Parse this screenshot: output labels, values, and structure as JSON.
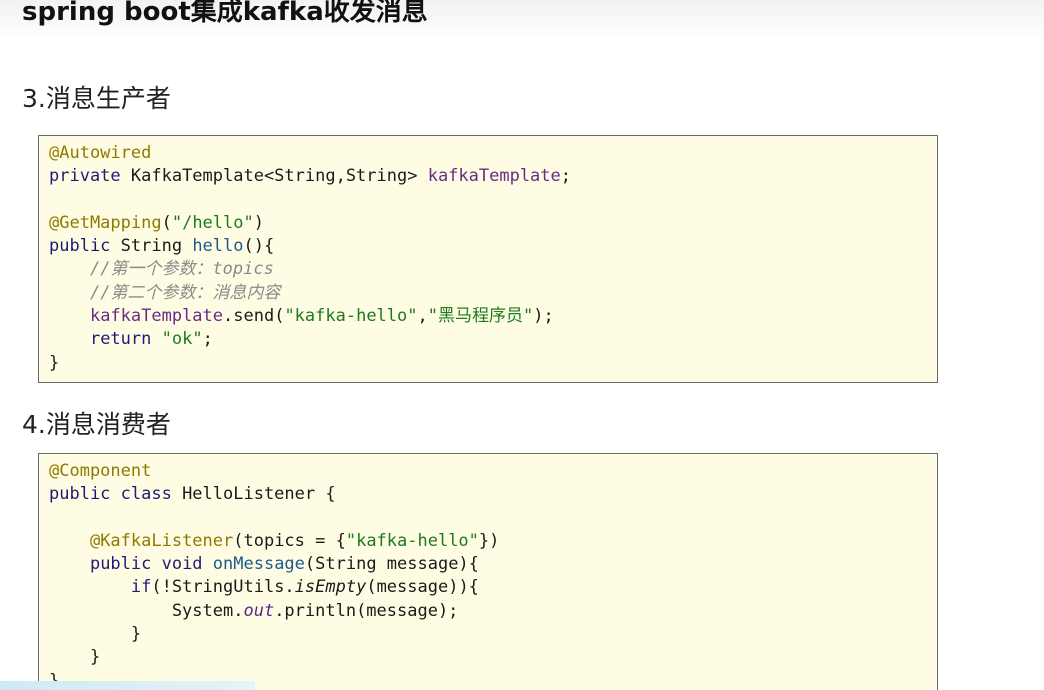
{
  "document": {
    "title": "spring boot集成kafka收发消息"
  },
  "producer": {
    "heading": "3.消息生产者",
    "lines": [
      [
        {
          "c": "ann",
          "t": "@Autowired"
        }
      ],
      [
        {
          "c": "kw",
          "t": "private "
        },
        {
          "c": "",
          "t": "KafkaTemplate<String,String> "
        },
        {
          "c": "fld",
          "t": "kafkaTemplate"
        },
        {
          "c": "",
          "t": ";"
        }
      ],
      [],
      [
        {
          "c": "ann",
          "t": "@GetMapping"
        },
        {
          "c": "",
          "t": "("
        },
        {
          "c": "str",
          "t": "\"/hello\""
        },
        {
          "c": "",
          "t": ")"
        }
      ],
      [
        {
          "c": "kw",
          "t": "public "
        },
        {
          "c": "",
          "t": "String "
        },
        {
          "c": "mth",
          "t": "hello"
        },
        {
          "c": "",
          "t": "(){"
        }
      ],
      [
        {
          "c": "",
          "t": "    "
        },
        {
          "c": "cmt",
          "t": "//第一个参数：topics"
        }
      ],
      [
        {
          "c": "",
          "t": "    "
        },
        {
          "c": "cmt",
          "t": "//第二个参数：消息内容"
        }
      ],
      [
        {
          "c": "",
          "t": "    "
        },
        {
          "c": "fld",
          "t": "kafkaTemplate"
        },
        {
          "c": "",
          "t": ".send("
        },
        {
          "c": "str",
          "t": "\"kafka-hello\""
        },
        {
          "c": "",
          "t": ","
        },
        {
          "c": "str",
          "t": "\"黑马程序员\""
        },
        {
          "c": "",
          "t": ");"
        }
      ],
      [
        {
          "c": "",
          "t": "    "
        },
        {
          "c": "kw",
          "t": "return "
        },
        {
          "c": "str",
          "t": "\"ok\""
        },
        {
          "c": "",
          "t": ";"
        }
      ],
      [
        {
          "c": "",
          "t": "}"
        }
      ]
    ]
  },
  "consumer": {
    "heading": "4.消息消费者",
    "lines": [
      [
        {
          "c": "ann",
          "t": "@Component"
        }
      ],
      [
        {
          "c": "kw",
          "t": "public class "
        },
        {
          "c": "",
          "t": "HelloListener {"
        }
      ],
      [],
      [
        {
          "c": "",
          "t": "    "
        },
        {
          "c": "ann",
          "t": "@KafkaListener"
        },
        {
          "c": "",
          "t": "(topics = {"
        },
        {
          "c": "str",
          "t": "\"kafka-hello\""
        },
        {
          "c": "",
          "t": "})"
        }
      ],
      [
        {
          "c": "",
          "t": "    "
        },
        {
          "c": "kw",
          "t": "public void "
        },
        {
          "c": "mth",
          "t": "onMessage"
        },
        {
          "c": "",
          "t": "(String message){"
        }
      ],
      [
        {
          "c": "",
          "t": "        "
        },
        {
          "c": "kw",
          "t": "if"
        },
        {
          "c": "",
          "t": "(!StringUtils."
        },
        {
          "c": "itl",
          "t": "isEmpty"
        },
        {
          "c": "",
          "t": "(message)){"
        }
      ],
      [
        {
          "c": "",
          "t": "            System."
        },
        {
          "c": "ofld",
          "t": "out"
        },
        {
          "c": "",
          "t": ".println(message);"
        }
      ],
      [
        {
          "c": "",
          "t": "        }"
        }
      ],
      [
        {
          "c": "",
          "t": "    }"
        }
      ],
      [
        {
          "c": "",
          "t": "}"
        }
      ]
    ]
  },
  "colors": {
    "code_background": "#fefde3",
    "code_border": "#6c6c6c",
    "annotation": "#8f7a00",
    "keyword": "#1f1a7a",
    "string": "#1e7a1e",
    "comment": "#8a8a8a"
  }
}
